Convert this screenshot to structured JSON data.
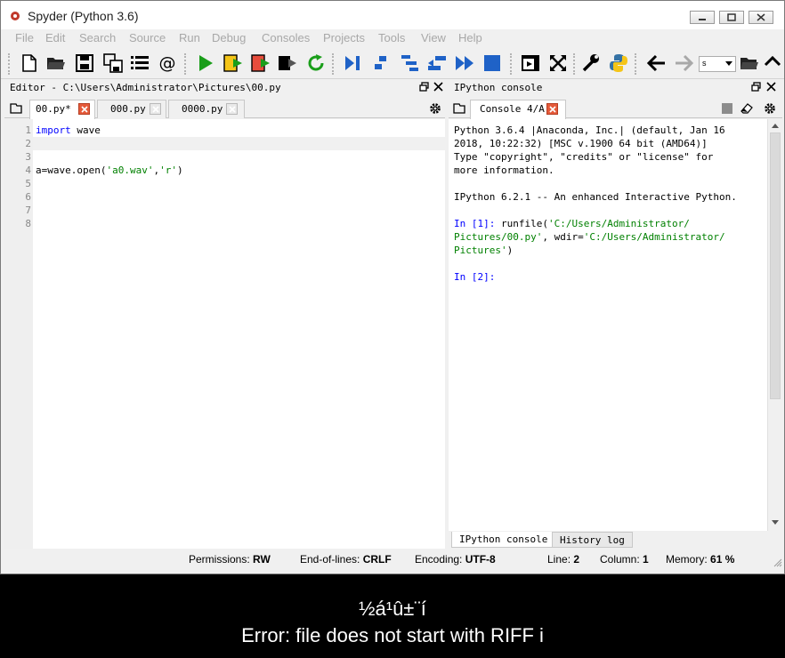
{
  "window": {
    "title": "Spyder (Python 3.6)"
  },
  "menu": [
    "File",
    "Edit",
    "Search",
    "Source",
    "Run",
    "Debug",
    "Consoles",
    "Projects",
    "Tools",
    "View",
    "Help"
  ],
  "toolbar": {
    "working_dir_value": "s",
    "icons": [
      "new-file-icon",
      "open-folder-icon",
      "save-icon",
      "save-all-icon",
      "outline-icon",
      "at-icon",
      "run-icon",
      "run-cell-icon",
      "run-cell-advance-icon",
      "run-selection-icon",
      "rerun-icon",
      "debug-icon",
      "step-icon",
      "step-into-icon",
      "step-return-icon",
      "continue-icon",
      "stop-icon",
      "maximize-pane-icon",
      "fullscreen-icon",
      "preferences-icon",
      "python-path-icon",
      "back-icon",
      "forward-icon",
      "browse-folder-icon"
    ]
  },
  "editor": {
    "pane_title": "Editor - C:\\Users\\Administrator\\Pictures\\00.py",
    "tabs": [
      {
        "label": "00.py*",
        "active": true
      },
      {
        "label": "000.py",
        "active": false
      },
      {
        "label": "0000.py",
        "active": false
      }
    ],
    "line_numbers": [
      "1",
      "2",
      "3",
      "4",
      "5",
      "6",
      "7",
      "8"
    ],
    "code": {
      "l1_kw": "import",
      "l1_rest": " wave",
      "l4_a": "a=wave.open(",
      "l4_s1": "'a0.wav'",
      "l4_c": ",",
      "l4_s2": "'r'",
      "l4_e": ")"
    }
  },
  "console": {
    "pane_title": "IPython console",
    "tab_label": "Console 4/A",
    "lines": [
      "Python 3.6.4 |Anaconda, Inc.| (default, Jan 16",
      "2018, 10:22:32) [MSC v.1900 64 bit (AMD64)]",
      "Type \"copyright\", \"credits\" or \"license\" for",
      "more information.",
      "IPython 6.2.1 -- An enhanced Interactive Python."
    ],
    "in1_prompt": "In [1]:",
    "in1_cmd_a": " runfile(",
    "in1_path1a": "'C:/Users/Administrator/",
    "in1_path1b": "Pictures/00.py'",
    "in1_cmd_b": ", wdir=",
    "in1_path2a": "'C:/Users/Administrator/",
    "in1_path2b": "Pictures'",
    "in1_close": ")",
    "in2_prompt": "In [2]:",
    "bottom_tabs": [
      "IPython console",
      "History log"
    ]
  },
  "status": {
    "permissions_label": "Permissions:",
    "permissions_value": "RW",
    "eol_label": "End-of-lines:",
    "eol_value": "CRLF",
    "encoding_label": "Encoding:",
    "encoding_value": "UTF-8",
    "line_label": "Line:",
    "line_value": "2",
    "column_label": "Column:",
    "column_value": "1",
    "memory_label": "Memory:",
    "memory_value": "61 %"
  },
  "subtitle": {
    "line1": "½á¹û±¨í",
    "line2": "Error: file does not start with RIFF i"
  }
}
